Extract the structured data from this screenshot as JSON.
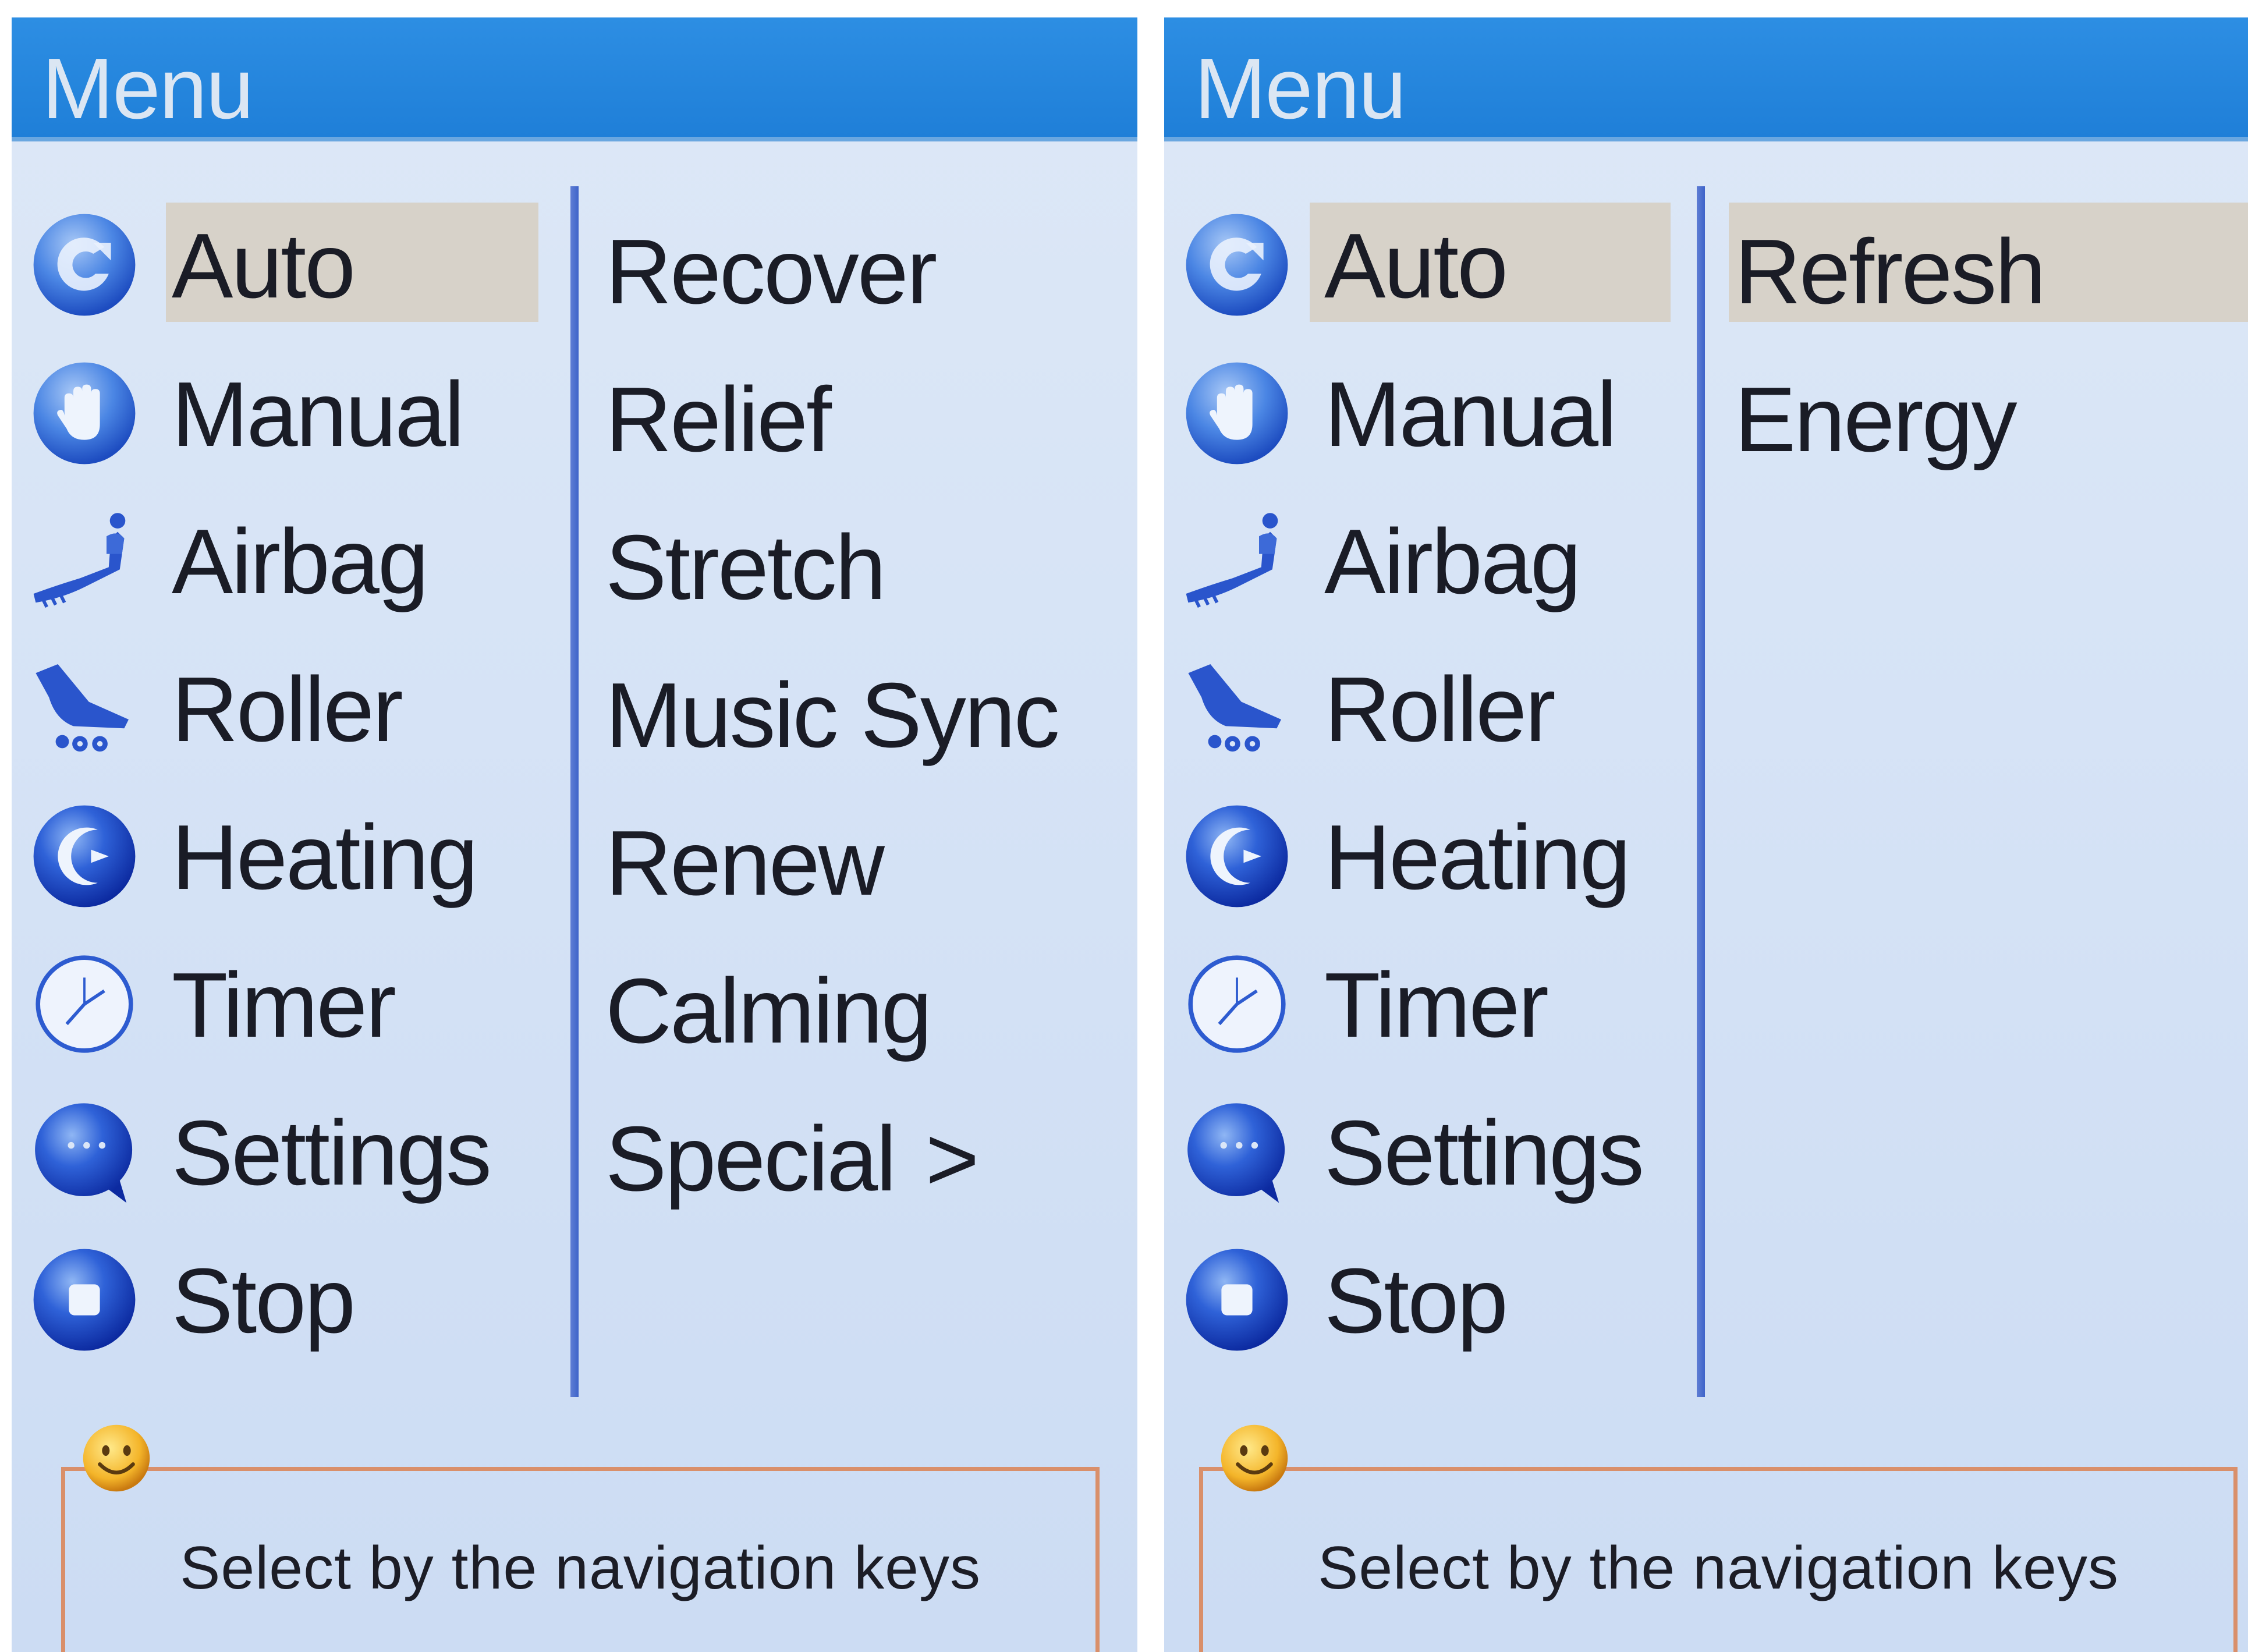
{
  "left_screen": {
    "title": "Menu",
    "menu_items": [
      {
        "label": "Auto",
        "icon": "auto-icon",
        "selected": true
      },
      {
        "label": "Manual",
        "icon": "hand-icon"
      },
      {
        "label": "Airbag",
        "icon": "airbag-icon"
      },
      {
        "label": "Roller",
        "icon": "roller-icon"
      },
      {
        "label": "Heating",
        "icon": "heating-icon"
      },
      {
        "label": "Timer",
        "icon": "clock-icon"
      },
      {
        "label": "Settings",
        "icon": "chat-bubble-icon"
      },
      {
        "label": "Stop",
        "icon": "stop-icon"
      }
    ],
    "submenu": [
      {
        "label": "Recover"
      },
      {
        "label": "Relief"
      },
      {
        "label": "Stretch"
      },
      {
        "label": "Music Sync"
      },
      {
        "label": "Renew"
      },
      {
        "label": "Calming"
      },
      {
        "label": "Special",
        "arrow": ">"
      }
    ],
    "hint": "Select by the navigation keys"
  },
  "right_screen": {
    "title": "Menu",
    "menu_items": [
      {
        "label": "Auto",
        "icon": "auto-icon",
        "selected": true
      },
      {
        "label": "Manual",
        "icon": "hand-icon"
      },
      {
        "label": "Airbag",
        "icon": "airbag-icon"
      },
      {
        "label": "Roller",
        "icon": "roller-icon"
      },
      {
        "label": "Heating",
        "icon": "heating-icon"
      },
      {
        "label": "Timer",
        "icon": "clock-icon"
      },
      {
        "label": "Settings",
        "icon": "chat-bubble-icon"
      },
      {
        "label": "Stop",
        "icon": "stop-icon"
      }
    ],
    "submenu": [
      {
        "label": "Refresh",
        "selected": true
      },
      {
        "label": "Energy"
      }
    ],
    "hint": "Select by the navigation keys"
  },
  "colors": {
    "titlebar": "#1f7fd8",
    "screen_bg": "#d3e1f5",
    "highlight": "#d7d2c9",
    "divider": "#4a6ccc",
    "icon_blue": "#1f49c8",
    "hint_border": "#d98f6a"
  }
}
